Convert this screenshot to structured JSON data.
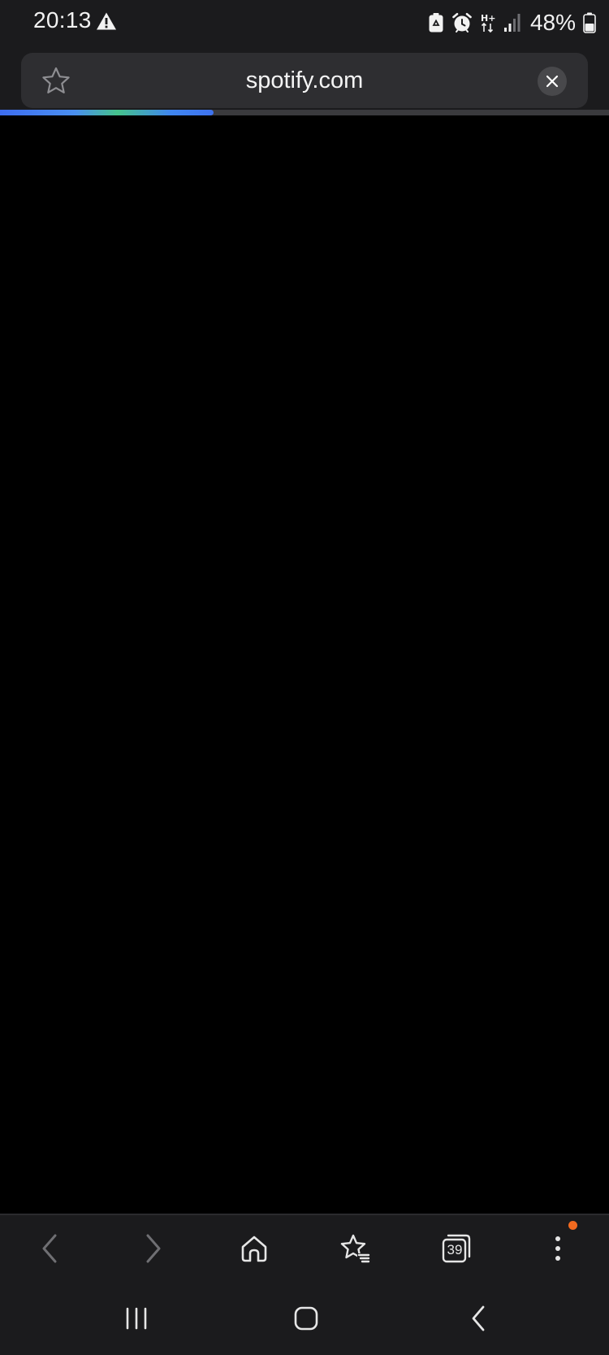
{
  "status_bar": {
    "time": "20:13",
    "battery_percent": "48%",
    "battery_level": 0.48,
    "icons": [
      "warning-icon",
      "recycle-icon",
      "alarm-icon",
      "network-hplus-icon",
      "signal-icon",
      "battery-icon"
    ],
    "network_label": "H+"
  },
  "browser": {
    "url": "spotify.com",
    "load_progress": 0.35,
    "progress_colors": [
      "#3d6df0",
      "#45c38c"
    ],
    "toolbar": {
      "tab_count": "39",
      "menu_badge_color": "#f26a1f",
      "buttons": [
        "back-icon",
        "forward-icon",
        "home-icon",
        "bookmarks-icon",
        "tabs-icon",
        "more-options-icon"
      ]
    }
  },
  "system_nav": {
    "buttons": [
      "recent-apps-icon",
      "home-icon",
      "back-icon"
    ]
  },
  "colors": {
    "bar_background": "#1b1b1d",
    "url_field": "#2e2e31",
    "content_background": "#000000"
  }
}
